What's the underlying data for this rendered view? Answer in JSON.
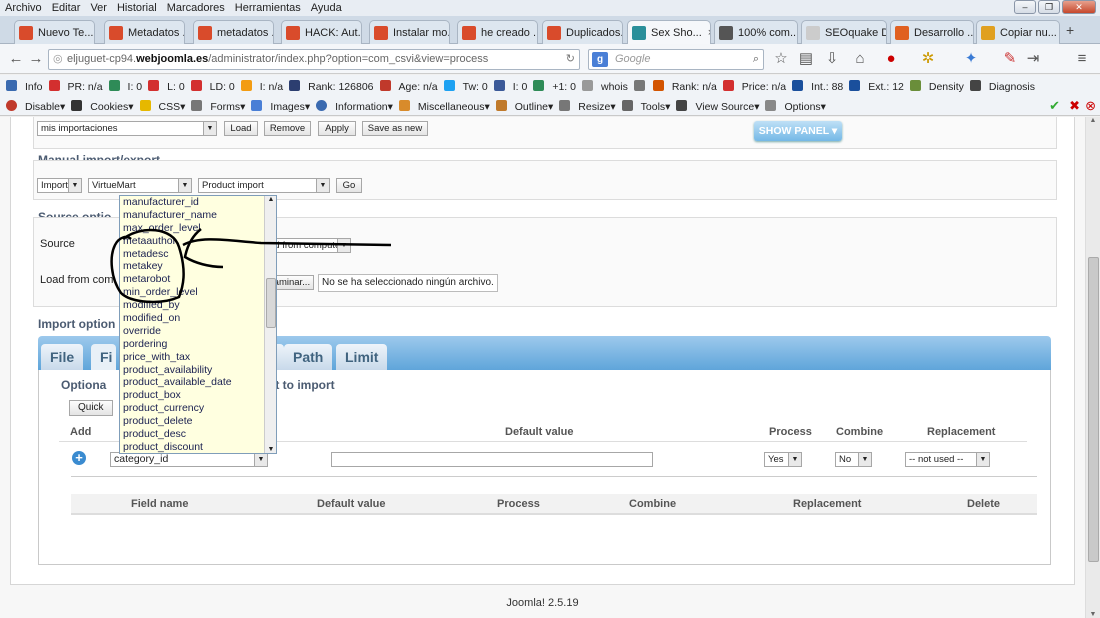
{
  "menu": [
    "Archivo",
    "Editar",
    "Ver",
    "Historial",
    "Marcadores",
    "Herramientas",
    "Ayuda"
  ],
  "tabs": [
    {
      "label": "Nuevo Te...",
      "color": "#d94b2b"
    },
    {
      "label": "Metadatos ...",
      "color": "#d94b2b"
    },
    {
      "label": "metadatos ...",
      "color": "#d94b2b"
    },
    {
      "label": "HACK: Aut...",
      "color": "#d94b2b"
    },
    {
      "label": "Instalar mo...",
      "color": "#d94b2b"
    },
    {
      "label": "he creado ...",
      "color": "#d94b2b"
    },
    {
      "label": "Duplicados...",
      "color": "#d94b2b"
    },
    {
      "label": "Sex Sho...",
      "color": "#2a8f9a",
      "active": true,
      "close": "×"
    },
    {
      "label": "100% com...",
      "color": "#555555"
    },
    {
      "label": "SEOquake Diag...",
      "color": "#cccccc"
    },
    {
      "label": "Desarrollo ...",
      "color": "#e06020"
    },
    {
      "label": "Copiar nu...",
      "color": "#e0a020"
    }
  ],
  "nav": {
    "url_prefix": "eljuguet-cp94.",
    "url_domain": "webjoomla.es",
    "url_suffix": "/administrator/index.php?option=com_csvi&view=process",
    "search_placeholder": "Google"
  },
  "seo_toolbar": [
    "Info",
    "PR: n/a",
    "I: 0",
    "L: 0",
    "LD: 0",
    "I: n/a",
    "Rank: 126806",
    "Age: n/a",
    "Tw: 0",
    "I: 0",
    "+1: 0",
    "whois",
    "",
    "Rank: n/a",
    "Price: n/a",
    "Int.: 88",
    "Ext.: 12",
    "Density",
    "Diagnosis"
  ],
  "dev_toolbar": [
    "Disable▾",
    "Cookies▾",
    "CSS▾",
    "Forms▾",
    "Images▾",
    "Information▾",
    "Miscellaneous▾",
    "Outline▾",
    "Resize▾",
    "Tools▾",
    "View Source▾",
    "Options▾"
  ],
  "template": {
    "select": "mis importaciones",
    "load": "Load",
    "remove": "Remove",
    "apply": "Apply",
    "save_as_new": "Save as new",
    "show_panel": "SHOW PANEL"
  },
  "manual": {
    "title": "Manual import/export",
    "action": "Import",
    "component": "VirtueMart",
    "operation": "Product import",
    "go": "Go"
  },
  "source": {
    "title": "Source optio",
    "label": "Source",
    "source_value": "ad from computer",
    "load_label": "Load from com",
    "browse": "xaminar...",
    "no_file": "No se ha seleccionado ningún archivo."
  },
  "import_options": {
    "title": "Import option",
    "tabs": [
      "File",
      "Fi",
      "e",
      "Path",
      "Limit"
    ],
    "optional_title": "Optiona",
    "optional_rest": "want to import",
    "quick": "Quick"
  },
  "fields_table": {
    "headers": {
      "add": "Add",
      "default": "Default value",
      "process": "Process",
      "combine": "Combine",
      "replacement": "Replacement"
    },
    "row": {
      "add_icon": "+",
      "field": "category_id",
      "process": "Yes",
      "combine": "No",
      "replacement": "-- not used --"
    },
    "list_headers": {
      "field_name": "Field name",
      "default": "Default value",
      "process": "Process",
      "combine": "Combine",
      "replacement": "Replacement",
      "delete": "Delete"
    }
  },
  "dropdown_items": [
    "manufacturer_id",
    "manufacturer_name",
    "max_order_level",
    "metaauthor",
    "metadesc",
    "metakey",
    "metarobot",
    "min_order_level",
    "modified_by",
    "modified_on",
    "override",
    "pordering",
    "price_with_tax",
    "product_availability",
    "product_available_date",
    "product_box",
    "product_currency",
    "product_delete",
    "product_desc",
    "product_discount"
  ],
  "footer": "Joomla! 2.5.19"
}
